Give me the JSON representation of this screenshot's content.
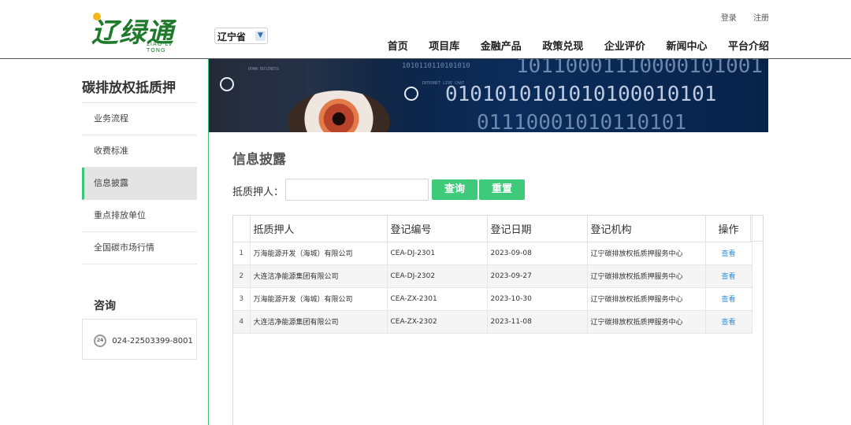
{
  "header": {
    "logo_text": "辽绿通",
    "logo_sub": "LIAO LV TONG",
    "province": "辽宁省",
    "top_links": [
      "登录",
      "注册"
    ],
    "nav": [
      "首页",
      "项目库",
      "金融产品",
      "政策兑现",
      "企业评价",
      "新闻中心",
      "平台介绍"
    ]
  },
  "sidebar": {
    "title": "碳排放权抵质押",
    "items": [
      "业务流程",
      "收费标准",
      "信息披露",
      "重点排放单位",
      "全国碳市场行情"
    ],
    "active_index": 2,
    "consult_title": "咨询",
    "phone": "024-22503399-8001"
  },
  "banner": {
    "binary_lines": [
      "1010110110101010",
      "10110001110000101001",
      "0101010101010100010101",
      "01110001010110101"
    ],
    "small_texts": [
      "DOWN BUSINESS",
      "INTERNET LIVE CHAT"
    ]
  },
  "main": {
    "title": "信息披露",
    "search_label": "抵质押人：",
    "search_value": "",
    "search_placeholder": "",
    "query_button": "查询",
    "reset_button": "重置"
  },
  "table": {
    "headers": [
      "",
      "抵质押人",
      "登记编号",
      "登记日期",
      "登记机构",
      "操作"
    ],
    "rows": [
      {
        "index": "1",
        "pledger": "万海能源开发（海城）有限公司",
        "reg_no": "CEA-DJ-2301",
        "date": "2023-09-08",
        "org": "辽宁碳排放权抵质押服务中心",
        "action": "查看"
      },
      {
        "index": "2",
        "pledger": "大连洁净能源集团有限公司",
        "reg_no": "CEA-DJ-2302",
        "date": "2023-09-27",
        "org": "辽宁碳排放权抵质押服务中心",
        "action": "查看"
      },
      {
        "index": "3",
        "pledger": "万海能源开发（海城）有限公司",
        "reg_no": "CEA-ZX-2301",
        "date": "2023-10-30",
        "org": "辽宁碳排放权抵质押服务中心",
        "action": "查看"
      },
      {
        "index": "4",
        "pledger": "大连洁净能源集团有限公司",
        "reg_no": "CEA-ZX-2302",
        "date": "2023-11-08",
        "org": "辽宁碳排放权抵质押服务中心",
        "action": "查看"
      }
    ]
  },
  "colors": {
    "accent": "#3fca7a",
    "link": "#2e8fd6",
    "logo": "#1f7a2c"
  }
}
